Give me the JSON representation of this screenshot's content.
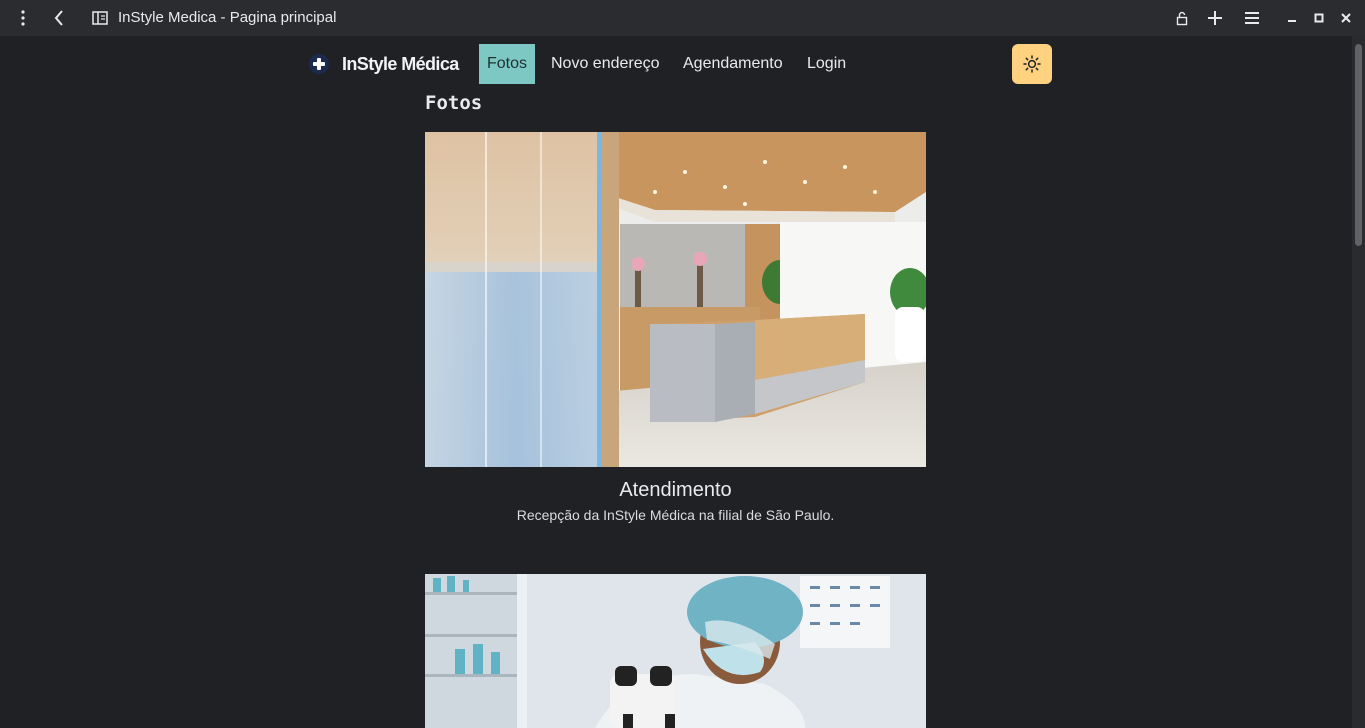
{
  "browser": {
    "window_title": "InStyle Medica - Pagina principal",
    "icons": {
      "menu": "kebab-menu-icon",
      "back": "back-arrow-icon",
      "sidebar": "sidebar-panel-icon",
      "lock": "unlock-icon",
      "new_tab": "plus-icon",
      "tabs_menu": "hamburger-icon",
      "minimize": "minimize-icon",
      "maximize": "maximize-icon",
      "close": "close-icon"
    }
  },
  "navbar": {
    "brand": "InStyle Médica",
    "links": [
      {
        "label": "Fotos",
        "active": true
      },
      {
        "label": "Novo endereço",
        "active": false
      },
      {
        "label": "Agendamento",
        "active": false
      },
      {
        "label": "Login",
        "active": false
      }
    ],
    "theme_toggle_icon": "sun-icon"
  },
  "colors": {
    "page_bg": "#202124",
    "active_nav": "#7ec8c4",
    "theme_toggle_bg": "#ffd27f",
    "brand_logo": "#1b2a4e"
  },
  "content": {
    "section_title": "Fotos",
    "photos": [
      {
        "title": "Atendimento",
        "description": "Recepção da InStyle Médica na filial de São Paulo."
      },
      {
        "title": "",
        "description": ""
      }
    ]
  }
}
